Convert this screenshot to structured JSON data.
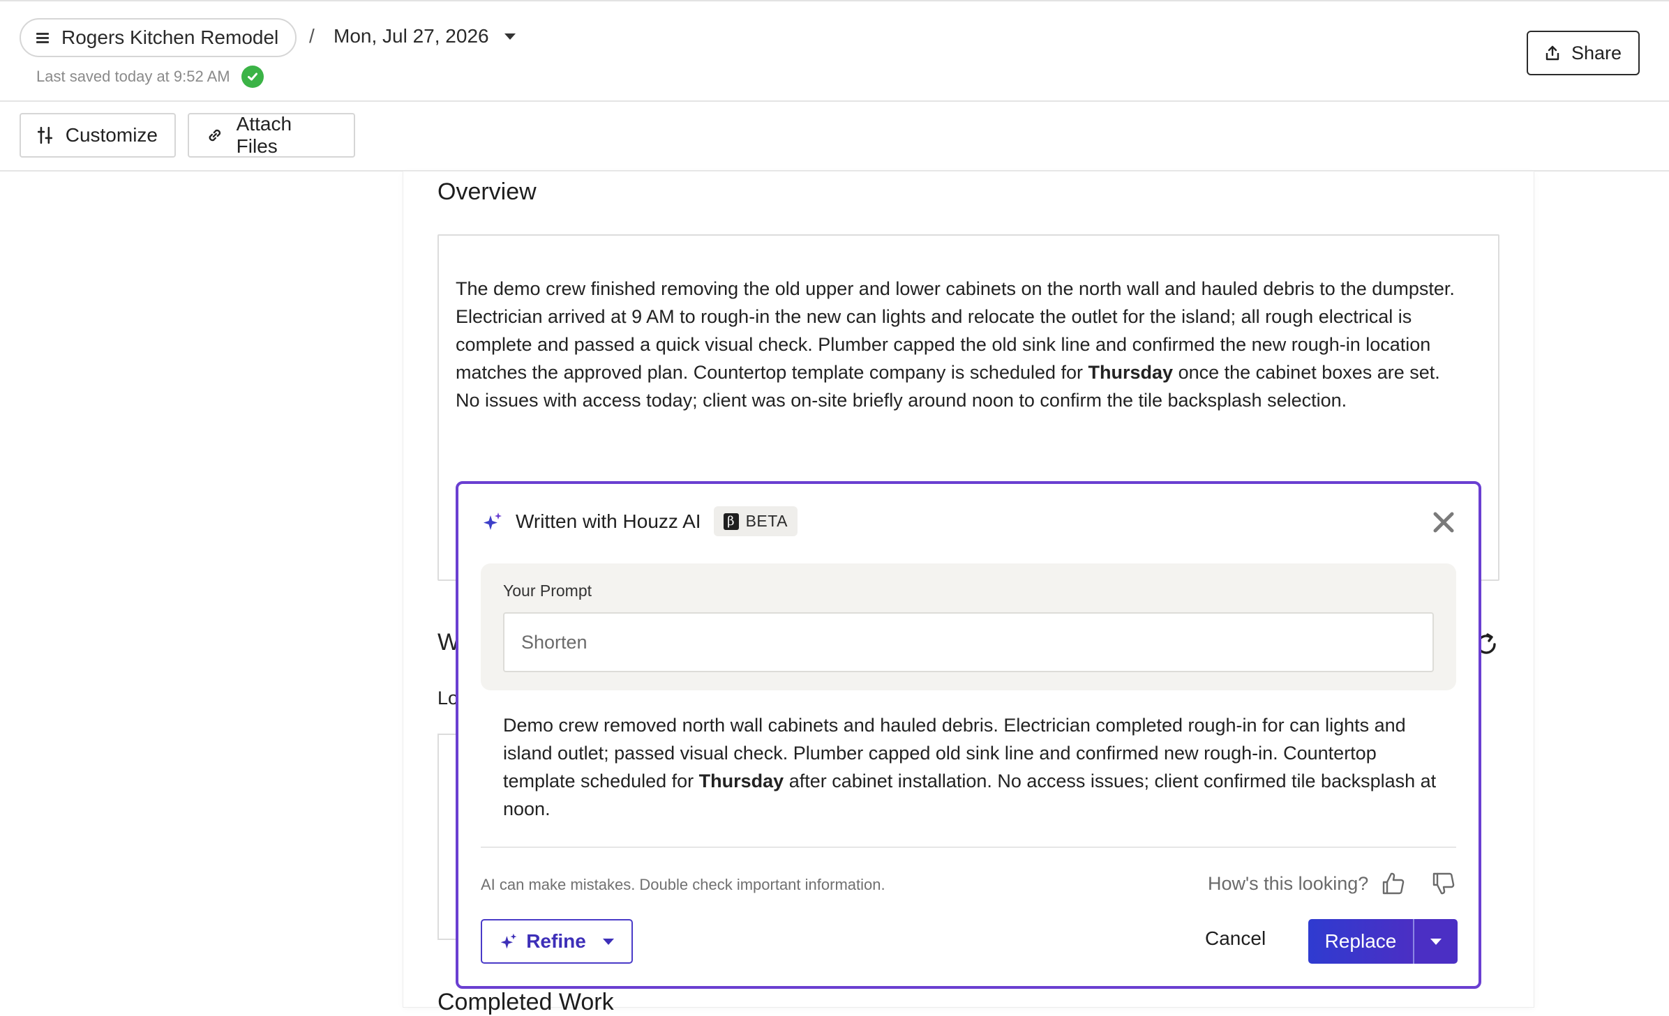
{
  "header": {
    "project_name": "Rogers Kitchen Remodel",
    "separator": "/",
    "date": "Mon, Jul 27, 2026",
    "saved_status": "Last saved today at 9:52 AM",
    "share_label": "Share"
  },
  "toolbar": {
    "customize_label": "Customize",
    "attach_label": "Attach Files"
  },
  "overview": {
    "title": "Overview",
    "text_before": "The demo crew finished removing the old upper and lower cabinets on the north wall and hauled debris to the dumpster. Electrician arrived at 9 AM to rough-in the new can lights and relocate the outlet for the island; all rough electrical is complete and passed a quick visual check. Plumber capped the old sink line and confirmed the new rough-in location matches the approved plan. Countertop template company is scheduled for ",
    "text_bold": "Thursday",
    "text_after": " once the cabinet boxes are set. No issues with access today; client was on-site briefly around noon to confirm the tile backsplash selection."
  },
  "background": {
    "partial_heading": "W",
    "partial_label": "Lo",
    "completed_work_title": "Completed Work"
  },
  "ai_panel": {
    "title": "Written with Houzz AI",
    "badge": "BETA",
    "badge_glyph": "β",
    "prompt_label": "Your Prompt",
    "prompt_value": "Shorten",
    "result_before": "Demo crew removed north wall cabinets and hauled debris. Electrician completed rough-in for can lights and island outlet; passed visual check. Plumber capped old sink line and confirmed new rough-in. Countertop template scheduled for ",
    "result_bold": "Thursday",
    "result_after": " after cabinet installation. No access issues; client confirmed tile backsplash at noon.",
    "disclaimer": "AI can make mistakes. Double check important information.",
    "feedback_prompt": "How's this looking?",
    "refine_label": "Refine",
    "cancel_label": "Cancel",
    "replace_label": "Replace"
  },
  "colors": {
    "ai_border": "#6a3fd1",
    "primary_button": "#2f3bd0",
    "saved_check": "#3bb346"
  },
  "icons": [
    "menu-icon",
    "chevron-down-icon",
    "check-circle-icon",
    "share-icon",
    "sliders-icon",
    "link-icon",
    "refresh-icon",
    "sparkle-icon",
    "close-icon",
    "thumbs-up-icon",
    "thumbs-down-icon"
  ]
}
